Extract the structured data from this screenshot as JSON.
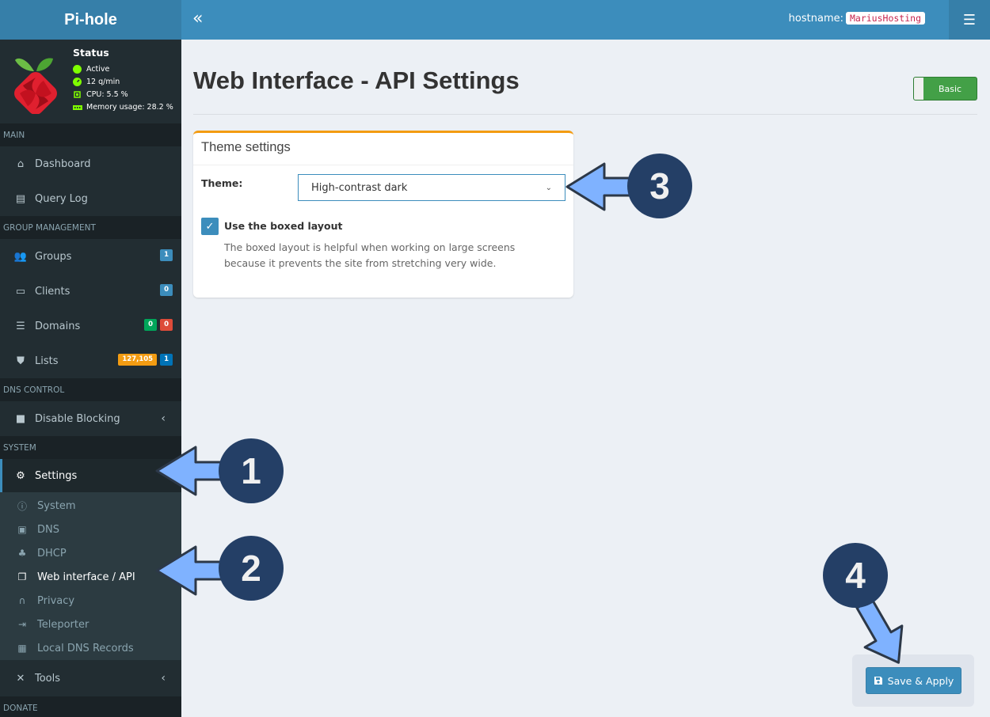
{
  "header": {
    "logo_text": "Pi-hole",
    "collapse_icon": "«",
    "hostname_label": "hostname:",
    "hostname_value": "MariusHosting",
    "menu_icon": "☰"
  },
  "status": {
    "title": "Status",
    "lines": [
      {
        "icon": "status-dot-icon",
        "text": "Active"
      },
      {
        "icon": "gauge-icon",
        "text": "12 q/min"
      },
      {
        "icon": "cpu-icon",
        "text": "CPU: 5.5 %"
      },
      {
        "icon": "memory-icon",
        "text": "Memory usage: 28.2 %"
      }
    ],
    "color": "#7fff00"
  },
  "sidebar": {
    "sections": {
      "main": "MAIN",
      "group_management": "GROUP MANAGEMENT",
      "dns_control": "DNS CONTROL",
      "system": "SYSTEM",
      "donate": "DONATE"
    },
    "items": {
      "dashboard": "Dashboard",
      "query_log": "Query Log",
      "groups": {
        "label": "Groups",
        "badges": [
          "1"
        ]
      },
      "clients": {
        "label": "Clients",
        "badges": [
          "0"
        ]
      },
      "domains": {
        "label": "Domains",
        "badges": [
          "0",
          "0"
        ]
      },
      "lists": {
        "label": "Lists",
        "badges": [
          "127,105",
          "1"
        ]
      },
      "disable_blocking": "Disable Blocking",
      "settings": "Settings",
      "tools": "Tools"
    },
    "settings_sub": {
      "system": "System",
      "dns": "DNS",
      "dhcp": "DHCP",
      "web_interface": "Web interface / API",
      "privacy": "Privacy",
      "teleporter": "Teleporter",
      "local_dns": "Local DNS Records"
    }
  },
  "page": {
    "title": "Web Interface - API Settings",
    "mode_toggle": "Basic"
  },
  "theme_box": {
    "title": "Theme settings",
    "theme_label": "Theme:",
    "theme_value": "High-contrast dark",
    "boxed_label": "Use the boxed layout",
    "boxed_checked": true,
    "boxed_help": "The boxed layout is helpful when working on large screens because it prevents the site from stretching very wide."
  },
  "actions": {
    "save_label": "Save & Apply"
  },
  "annotations": [
    "1",
    "2",
    "3",
    "4"
  ],
  "colors": {
    "accent": "#3c8dbc",
    "box_border": "#f39c12",
    "arrow": "#7fb2ff",
    "callout": "#243f66"
  }
}
